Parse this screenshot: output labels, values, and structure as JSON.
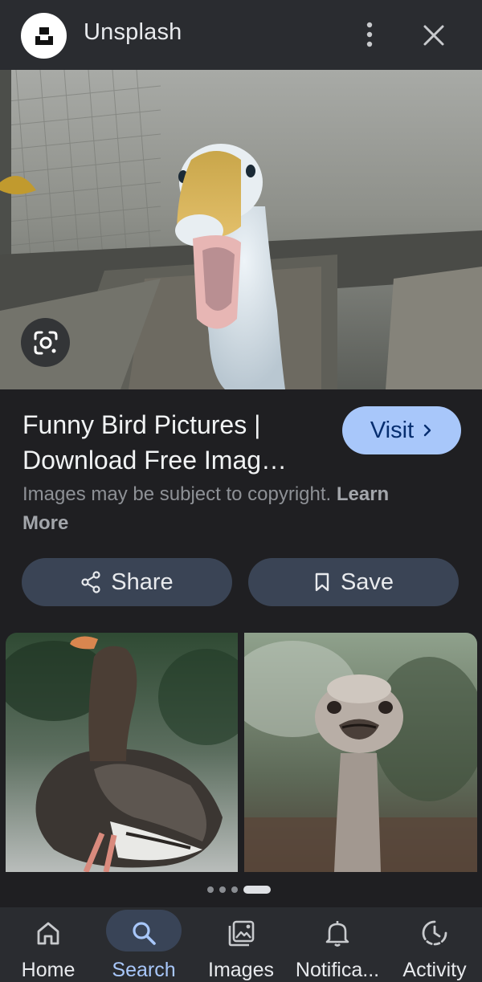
{
  "header": {
    "site_name": "Unsplash",
    "more_icon": "more-vert-icon",
    "close_icon": "close-icon"
  },
  "result": {
    "title": "Funny Bird Pictures | Download Free Imag…",
    "visit_label": "Visit",
    "copyright_text": "Images may be subject to copyright.",
    "learn_more_label": "Learn More",
    "share_label": "Share",
    "save_label": "Save"
  },
  "related": {
    "items": [
      {
        "subject": "goose"
      },
      {
        "subject": "ostrich"
      }
    ],
    "page_count": 4,
    "active_page": 4
  },
  "bottom_nav": {
    "items": [
      {
        "label": "Home",
        "icon": "home-icon",
        "active": false
      },
      {
        "label": "Search",
        "icon": "search-icon",
        "active": true
      },
      {
        "label": "Images",
        "icon": "images-icon",
        "active": false
      },
      {
        "label": "Notifica...",
        "icon": "bell-icon",
        "active": false
      },
      {
        "label": "Activity",
        "icon": "activity-icon",
        "active": false
      }
    ]
  },
  "colors": {
    "background": "#1f1f22",
    "surface": "#2a2c30",
    "accent": "#a8c7fa",
    "pill": "#3a4455"
  }
}
